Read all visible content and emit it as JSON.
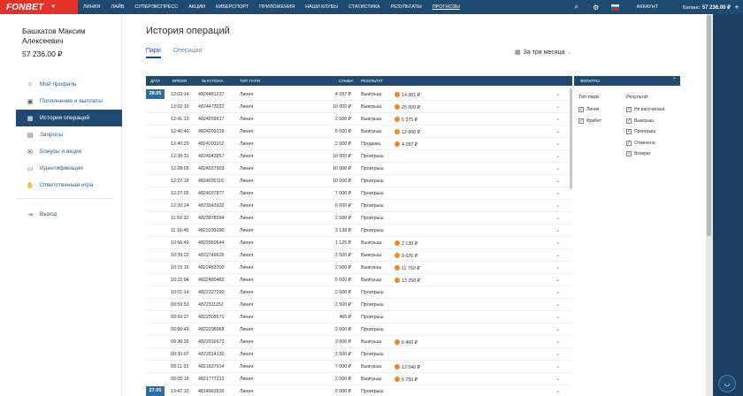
{
  "brand": "FONBET",
  "nav": [
    "Линия",
    "Лайв",
    "Суперэкспресс",
    "Акции",
    "Киберспорт",
    "Приложения",
    "Наши клубы",
    "Статистика",
    "Результаты",
    "Прогнозы"
  ],
  "account_label": "Аккаунт",
  "balance_label": "Баланс:",
  "balance_value": "57 236.00 ₽",
  "user": {
    "name": "Башкатов Максим Алексеевич",
    "balance": "57 236.00 ₽"
  },
  "menu": [
    {
      "label": "Мой профиль",
      "icon": "person-icon"
    },
    {
      "label": "Пополнение и выплаты",
      "icon": "wallet-icon"
    },
    {
      "label": "История операций",
      "icon": "calendar-icon",
      "active": true
    },
    {
      "label": "Запросы",
      "icon": "document-icon"
    },
    {
      "label": "Бонусы и акции",
      "icon": "gift-icon"
    },
    {
      "label": "Идентификация",
      "icon": "id-card-icon"
    },
    {
      "label": "Ответственная игра",
      "icon": "hand-icon"
    }
  ],
  "logout": "Выход",
  "page_title": "История операций",
  "tabs": [
    "Пари",
    "Операции"
  ],
  "period": "За три месяца",
  "table": {
    "headers": [
      "Дата",
      "Время",
      "№ купона",
      "Тип пари",
      "Сумма",
      "Результат"
    ],
    "rows": [
      {
        "date": "28.05",
        "time": "13:03:14",
        "coupon": "4824481237",
        "type": "Линия",
        "sum": "4 287 ₽",
        "result": "Выигрыш",
        "payout": "14 361 ₽"
      },
      {
        "time": "13:02:10",
        "coupon": "4824473022",
        "type": "Линия",
        "sum": "10 000 ₽",
        "result": "Выигрыш",
        "payout": "25 000 ₽"
      },
      {
        "time": "12:41:13",
        "coupon": "4824209617",
        "type": "Линия",
        "sum": "2 500 ₽",
        "result": "Выигрыш",
        "payout": "5 375 ₽"
      },
      {
        "time": "12:40:40",
        "coupon": "4824203239",
        "type": "Линия",
        "sum": "5 000 ₽",
        "result": "Выигрыш",
        "payout": "12 500 ₽"
      },
      {
        "time": "12:40:29",
        "coupon": "4824201162",
        "type": "Линия",
        "sum": "2 500 ₽",
        "result": "Продажа",
        "payout": "4 287 ₽"
      },
      {
        "time": "12:28:31",
        "coupon": "4824043857",
        "type": "Линия",
        "sum": "10 000 ₽",
        "result": "Проигрыш",
        "payout": ""
      },
      {
        "time": "12:28:03",
        "coupon": "4824037903",
        "type": "Линия",
        "sum": "10 000 ₽",
        "result": "Проигрыш",
        "payout": ""
      },
      {
        "time": "12:27:18",
        "coupon": "4824030116",
        "type": "Линия",
        "sum": "10 000 ₽",
        "result": "Проигрыш",
        "payout": ""
      },
      {
        "time": "12:27:05",
        "coupon": "4824027877",
        "type": "Линия",
        "sum": "7 000 ₽",
        "result": "Проигрыш",
        "payout": ""
      },
      {
        "time": "12:20:24",
        "coupon": "4823943932",
        "type": "Линия",
        "sum": "5 000 ₽",
        "result": "Проигрыш",
        "payout": ""
      },
      {
        "time": "11:50:32",
        "coupon": "4823578594",
        "type": "Линия",
        "sum": "2 500 ₽",
        "result": "Проигрыш",
        "payout": ""
      },
      {
        "time": "11:16:49",
        "coupon": "4823193290",
        "type": "Линия",
        "sum": "3 138 ₽",
        "result": "Проигрыш",
        "payout": ""
      },
      {
        "time": "10:56:49",
        "coupon": "4822950644",
        "type": "Линия",
        "sum": "1 125 ₽",
        "result": "Выигрыш",
        "payout": "2 138 ₽"
      },
      {
        "time": "10:39:22",
        "coupon": "4822749626",
        "type": "Линия",
        "sum": "2 500 ₽",
        "result": "Выигрыш",
        "payout": "9 625 ₽"
      },
      {
        "time": "10:15:16",
        "coupon": "4822482200",
        "type": "Линия",
        "sum": "2 500 ₽",
        "result": "Выигрыш",
        "payout": "11 750 ₽"
      },
      {
        "time": "10:15:04",
        "coupon": "4822480482",
        "type": "Линия",
        "sum": "5 000 ₽",
        "result": "Выигрыш",
        "payout": "13 250 ₽"
      },
      {
        "time": "10:01:14",
        "coupon": "4822327290",
        "type": "Линия",
        "sum": "2 500 ₽",
        "result": "Проигрыш",
        "payout": ""
      },
      {
        "time": "09:59:53",
        "coupon": "4822311152",
        "type": "Линия",
        "sum": "2 500 ₽",
        "result": "Проигрыш",
        "payout": ""
      },
      {
        "time": "09:59:27",
        "coupon": "4822305571",
        "type": "Линия",
        "sum": "465 ₽",
        "result": "Проигрыш",
        "payout": ""
      },
      {
        "time": "09:56:49",
        "coupon": "4822298968",
        "type": "Линия",
        "sum": "3 500 ₽",
        "result": "Проигрыш",
        "payout": ""
      },
      {
        "time": "09:30:26",
        "coupon": "4822016673",
        "type": "Линия",
        "sum": "3 600 ₽",
        "result": "Выигрыш",
        "payout": "6 460 ₽"
      },
      {
        "time": "09:30:07",
        "coupon": "4822014130",
        "type": "Линия",
        "sum": "2 500 ₽",
        "result": "Проигрыш",
        "payout": ""
      },
      {
        "time": "09:11:33",
        "coupon": "4821837914",
        "type": "Линия",
        "sum": "7 000 ₽",
        "result": "Выигрыш",
        "payout": "12 040 ₽"
      },
      {
        "time": "09:05:18",
        "coupon": "4821777222",
        "type": "Линия",
        "sum": "2 500 ₽",
        "result": "Выигрыш",
        "payout": "6 750 ₽"
      },
      {
        "date": "27.05",
        "time": "19:47:10",
        "coupon": "4814963516",
        "type": "Линия",
        "sum": "2 000 ₽",
        "result": "Проигрыш",
        "payout": ""
      }
    ]
  },
  "filters": {
    "title": "Фильтры",
    "type_title": "Тип пари",
    "types": [
      "Линия",
      "Фрибет"
    ],
    "result_title": "Результат",
    "results": [
      "Не рассчитана",
      "Выигрыш",
      "Проигрыш",
      "Отменена",
      "Возврат"
    ]
  },
  "colors": {
    "header": "#1f4b72",
    "brand": "#e4322b",
    "coin": "#f08a1d"
  }
}
